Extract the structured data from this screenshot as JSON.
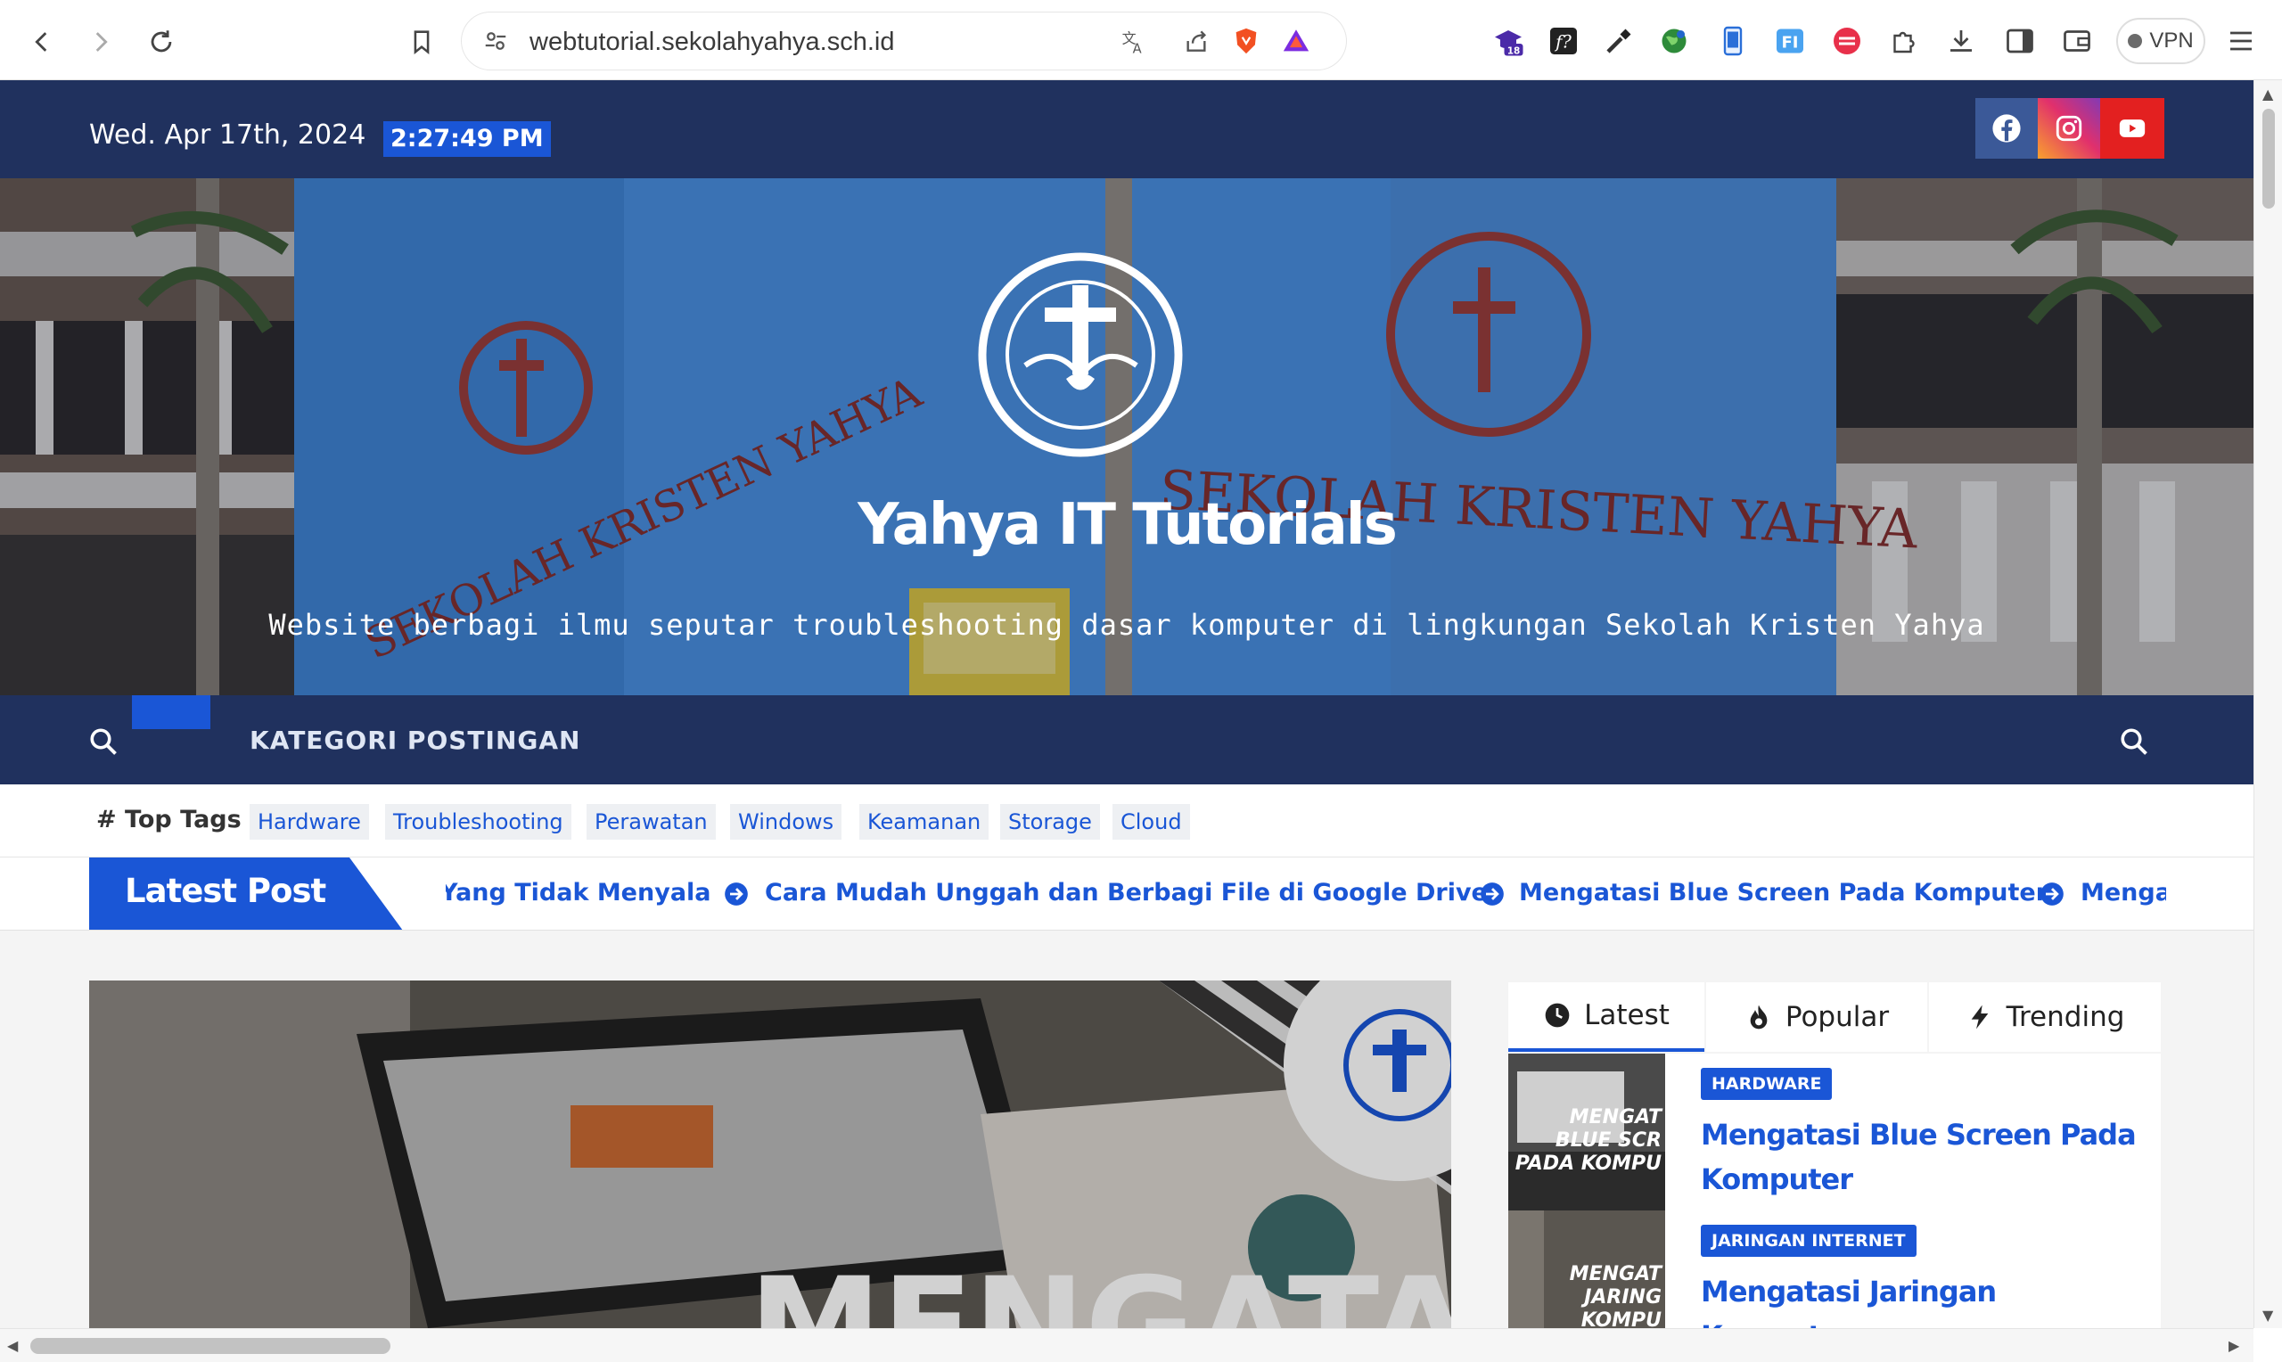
{
  "browser": {
    "url": "webtutorial.sekolahyahya.sch.id",
    "vpn_label": "VPN",
    "extension_badge": "18",
    "extensions": [
      "graduation-cap-icon",
      "font-identifier-icon",
      "eyedropper-icon",
      "globe-icon",
      "phone-icon",
      "f-icon",
      "lines-icon",
      "puzzle-icon",
      "download-icon",
      "sidebar-icon",
      "wallet-icon"
    ]
  },
  "header": {
    "date": "Wed. Apr 17th, 2024",
    "time": "2:27:49 PM",
    "social": [
      "facebook-icon",
      "instagram-icon",
      "youtube-icon"
    ]
  },
  "banner": {
    "title": "Yahya IT Tutorials",
    "description": "Website berbagi ilmu seputar troubleshooting dasar komputer di lingkungan Sekolah Kristen Yahya"
  },
  "nav": {
    "menu_label": "KATEGORI POSTINGAN"
  },
  "tags": {
    "title": "# Top Tags",
    "items": [
      "Hardware",
      "Troubleshooting",
      "Perawatan",
      "Windows",
      "Keamanan",
      "Storage",
      "Cloud"
    ]
  },
  "latest": {
    "label": "Latest Post",
    "ticker": [
      "Yang Tidak Menyala",
      "Cara Mudah Unggah dan Berbagi File di Google Drive",
      "Mengatasi Blue Screen Pada Komputer",
      "Mengatasi"
    ]
  },
  "sidebar": {
    "tabs": [
      "Latest",
      "Popular",
      "Trending"
    ],
    "posts": [
      {
        "category": "HARDWARE",
        "title": "Mengatasi Blue Screen Pada Komputer",
        "thumb_text": "MENGATASI BLUE SCREEN PADA KOMPUTER"
      },
      {
        "category": "JARINGAN INTERNET",
        "title": "Mengatasi Jaringan Komputer",
        "thumb_text": "MENGATASI JARINGAN KOMPUTER"
      }
    ]
  },
  "featured": {
    "headline": "MENGATASI"
  },
  "colors": {
    "navy": "#20315e",
    "accent": "#1a56d6"
  }
}
